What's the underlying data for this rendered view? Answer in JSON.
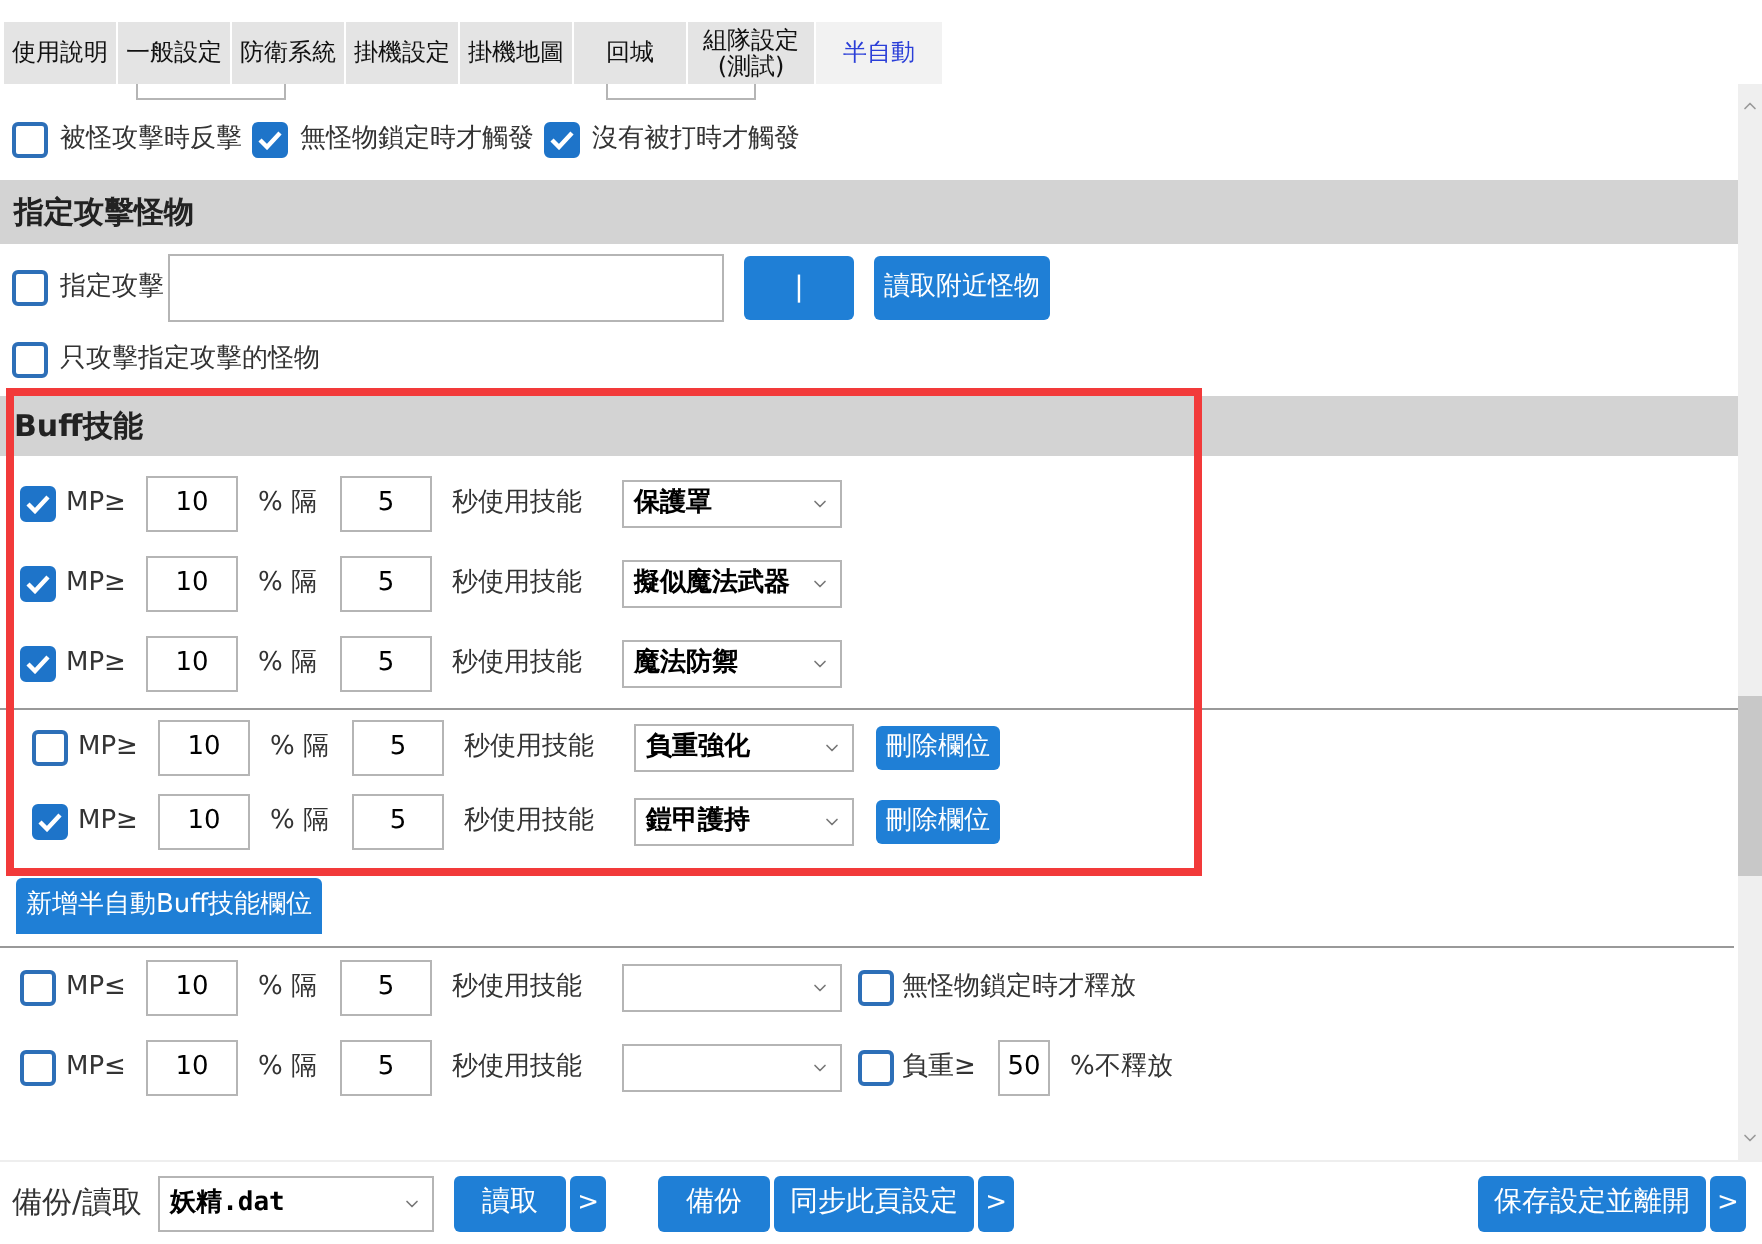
{
  "tabs": [
    {
      "label": "使用說明",
      "selected": false
    },
    {
      "label": "一般設定",
      "selected": false
    },
    {
      "label": "防衛系統",
      "selected": false
    },
    {
      "label": "掛機設定",
      "selected": false
    },
    {
      "label": "掛機地圖",
      "selected": false
    },
    {
      "label": "回城",
      "selected": false
    },
    {
      "label": "組隊設定\n(測試)",
      "selected": false
    },
    {
      "label": "半自動",
      "selected": true
    }
  ],
  "trigger_options": [
    {
      "label": "被怪攻擊時反擊",
      "checked": false
    },
    {
      "label": "無怪物鎖定時才觸發",
      "checked": true
    },
    {
      "label": "沒有被打時才觸發",
      "checked": true
    }
  ],
  "target_section": {
    "title": "指定攻擊怪物",
    "target_checkbox": {
      "label": "指定攻擊",
      "checked": false
    },
    "pick_button": "|",
    "read_button": "讀取附近怪物",
    "only_target": {
      "label": "只攻擊指定攻擊的怪物",
      "checked": false
    }
  },
  "buff_section": {
    "title": "Buff技能",
    "rows": [
      {
        "kind": "fixed",
        "checked": true,
        "label": "MP≥",
        "percent": "10",
        "interval_label": "% 隔",
        "seconds": "5",
        "skill_label": "秒使用技能",
        "skill": "保護罩"
      },
      {
        "kind": "fixed",
        "checked": true,
        "label": "MP≥",
        "percent": "10",
        "interval_label": "% 隔",
        "seconds": "5",
        "skill_label": "秒使用技能",
        "skill": "擬似魔法武器"
      },
      {
        "kind": "fixed",
        "checked": true,
        "label": "MP≥",
        "percent": "10",
        "interval_label": "% 隔",
        "seconds": "5",
        "skill_label": "秒使用技能",
        "skill": "魔法防禦"
      },
      {
        "kind": "removable",
        "checked": false,
        "label": "MP≥",
        "percent": "10",
        "interval_label": "% 隔",
        "seconds": "5",
        "skill_label": "秒使用技能",
        "skill": "負重強化",
        "delete_button": "刪除欄位"
      },
      {
        "kind": "removable",
        "checked": true,
        "label": "MP≥",
        "percent": "10",
        "interval_label": "% 隔",
        "seconds": "5",
        "skill_label": "秒使用技能",
        "skill": "鎧甲護持",
        "delete_button": "刪除欄位"
      }
    ],
    "add_button": "新增半自動Buff技能欄位"
  },
  "mp_rows": [
    {
      "kind": "lock",
      "checked": false,
      "label": "MP≤",
      "percent": "10",
      "interval_label": "% 隔",
      "seconds": "5",
      "skill_label": "秒使用技能",
      "option": {
        "label": "無怪物鎖定時才釋放",
        "checked": false
      }
    },
    {
      "kind": "weight",
      "checked": false,
      "label": "MP≤",
      "percent": "10",
      "interval_label": "% 隔",
      "seconds": "5",
      "skill_label": "秒使用技能",
      "option": {
        "label": "負重≥",
        "checked": false,
        "value": "50",
        "suffix": "%不釋放"
      }
    }
  ],
  "footer": {
    "label": "備份/讀取",
    "file": "妖精.dat",
    "buttons": [
      {
        "kind": "main",
        "label": "讀取"
      },
      {
        "kind": "more",
        "label": ">"
      },
      {
        "kind": "gap"
      },
      {
        "kind": "main",
        "label": "備份"
      },
      {
        "kind": "main",
        "label": "同步此頁設定"
      },
      {
        "kind": "more",
        "label": ">"
      },
      {
        "kind": "spacer"
      },
      {
        "kind": "main",
        "label": "保存設定並離開"
      },
      {
        "kind": "more",
        "label": ">"
      }
    ]
  }
}
